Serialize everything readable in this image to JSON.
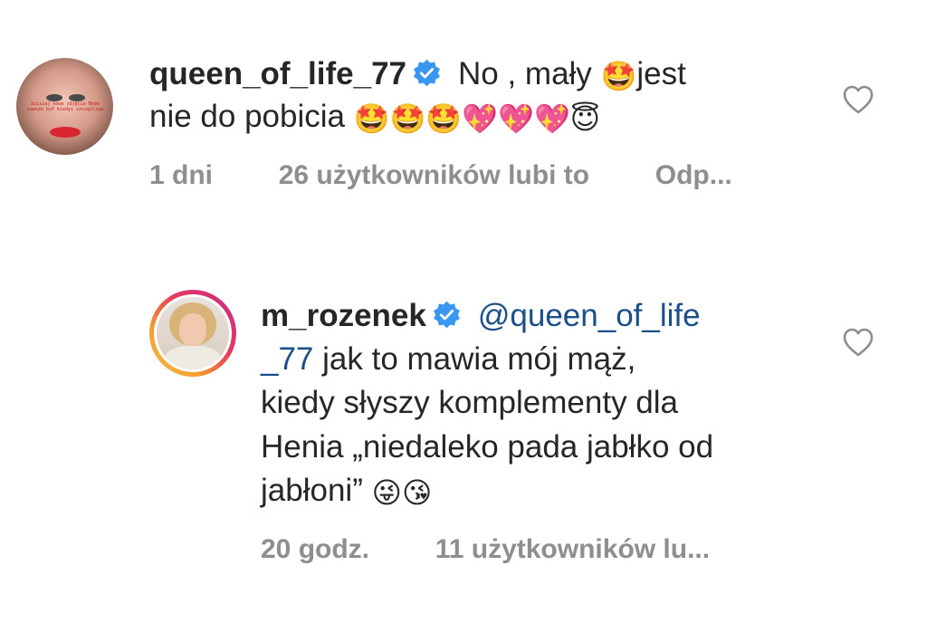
{
  "comments": [
    {
      "username": "queen_of_life_77",
      "avatar_watermark": "Dzisiaj nowe zdjęcia Bede zawsze był kiedys szczęśliwa",
      "text_line1": "No , mały",
      "text_line1_after": "jest",
      "text_line2": "nie do pobicia",
      "emojis_inline": "🤩",
      "emojis_line2": "🤩🤩🤩💖💖💖😇",
      "time": "1 dni",
      "likes": "26 użytkowników lubi to",
      "reply": "Odp..."
    },
    {
      "username": "m_rozenek",
      "mention_line1": "@queen_of_life",
      "mention_line2": "_77",
      "text_line2": "jak to mawia mój mąż,",
      "text_line3": "kiedy słyszy komplementy dla",
      "text_line4": "Henia „niedaleko pada jabłko od",
      "text_line5": "jabłoni”",
      "emojis": "😜😘",
      "time": "20 godz.",
      "likes": "11 użytkowników lu..."
    }
  ],
  "icons": {
    "verified": "verified-badge-icon",
    "like": "heart-icon"
  },
  "colors": {
    "verified": "#3897f0",
    "mention": "#1b4f8a",
    "meta": "#8e8e8e",
    "text": "#262626"
  }
}
